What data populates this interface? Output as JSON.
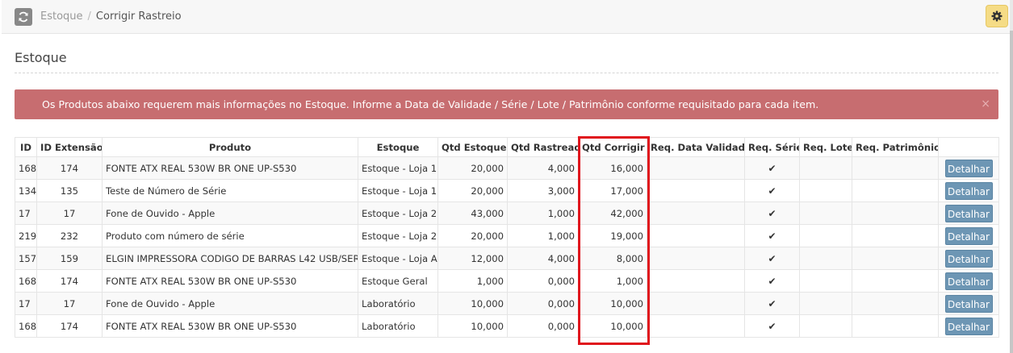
{
  "breadcrumb": {
    "root": "Estoque",
    "separator": "/",
    "current": "Corrigir Rastreio"
  },
  "page": {
    "title": "Estoque"
  },
  "alert": {
    "message": "Os Produtos abaixo requerem mais informações no Estoque. Informe a Data de Validade / Série / Lote / Patrimônio conforme requisitado para cada item.",
    "close_glyph": "×"
  },
  "table": {
    "headers": [
      "ID",
      "ID Extensão",
      "Produto",
      "Estoque",
      "Qtd Estoque",
      "Qtd Rastreada",
      "Qtd Corrigir",
      "Req. Data Validade",
      "Req. Série",
      "Req. Lote",
      "Req. Patrimônio",
      ""
    ],
    "check_glyph": "✔",
    "button_label": "Detalhar",
    "rows": [
      {
        "id": "168",
        "ext": "174",
        "produto": "FONTE ATX REAL 530W BR ONE UP-S530",
        "estoque": "Estoque - Loja 1",
        "qtd_estoque": "20,000",
        "qtd_rastreada": "4,000",
        "qtd_corrigir": "16,000"
      },
      {
        "id": "134",
        "ext": "135",
        "produto": "Teste de Número de Série",
        "estoque": "Estoque - Loja 1",
        "qtd_estoque": "20,000",
        "qtd_rastreada": "3,000",
        "qtd_corrigir": "17,000"
      },
      {
        "id": "17",
        "ext": "17",
        "produto": "Fone de Ouvido - Apple",
        "estoque": "Estoque - Loja 2",
        "qtd_estoque": "43,000",
        "qtd_rastreada": "1,000",
        "qtd_corrigir": "42,000"
      },
      {
        "id": "219",
        "ext": "232",
        "produto": "Produto com número de série",
        "estoque": "Estoque - Loja 2",
        "qtd_estoque": "20,000",
        "qtd_rastreada": "1,000",
        "qtd_corrigir": "19,000"
      },
      {
        "id": "157",
        "ext": "159",
        "produto": "ELGIN IMPRESSORA CODIGO DE BARRAS L42 USB/SER",
        "estoque": "Estoque - Loja A",
        "qtd_estoque": "12,000",
        "qtd_rastreada": "4,000",
        "qtd_corrigir": "8,000"
      },
      {
        "id": "168",
        "ext": "174",
        "produto": "FONTE ATX REAL 530W BR ONE UP-S530",
        "estoque": "Estoque Geral",
        "qtd_estoque": "1,000",
        "qtd_rastreada": "0,000",
        "qtd_corrigir": "1,000"
      },
      {
        "id": "17",
        "ext": "17",
        "produto": "Fone de Ouvido - Apple",
        "estoque": "Laboratório",
        "qtd_estoque": "10,000",
        "qtd_rastreada": "0,000",
        "qtd_corrigir": "10,000"
      },
      {
        "id": "168",
        "ext": "174",
        "produto": "FONTE ATX REAL 530W BR ONE UP-S530",
        "estoque": "Laboratório",
        "qtd_estoque": "10,000",
        "qtd_rastreada": "0,000",
        "qtd_corrigir": "10,000"
      }
    ]
  },
  "icons": {
    "refresh": "refresh-icon",
    "settings": "gear-icon",
    "check": "check-icon"
  },
  "colors": {
    "alert_bg": "#c76d70",
    "button_bg": "#6d96b4",
    "highlight": "#e0151d",
    "settings_bg": "#f5dc86"
  }
}
